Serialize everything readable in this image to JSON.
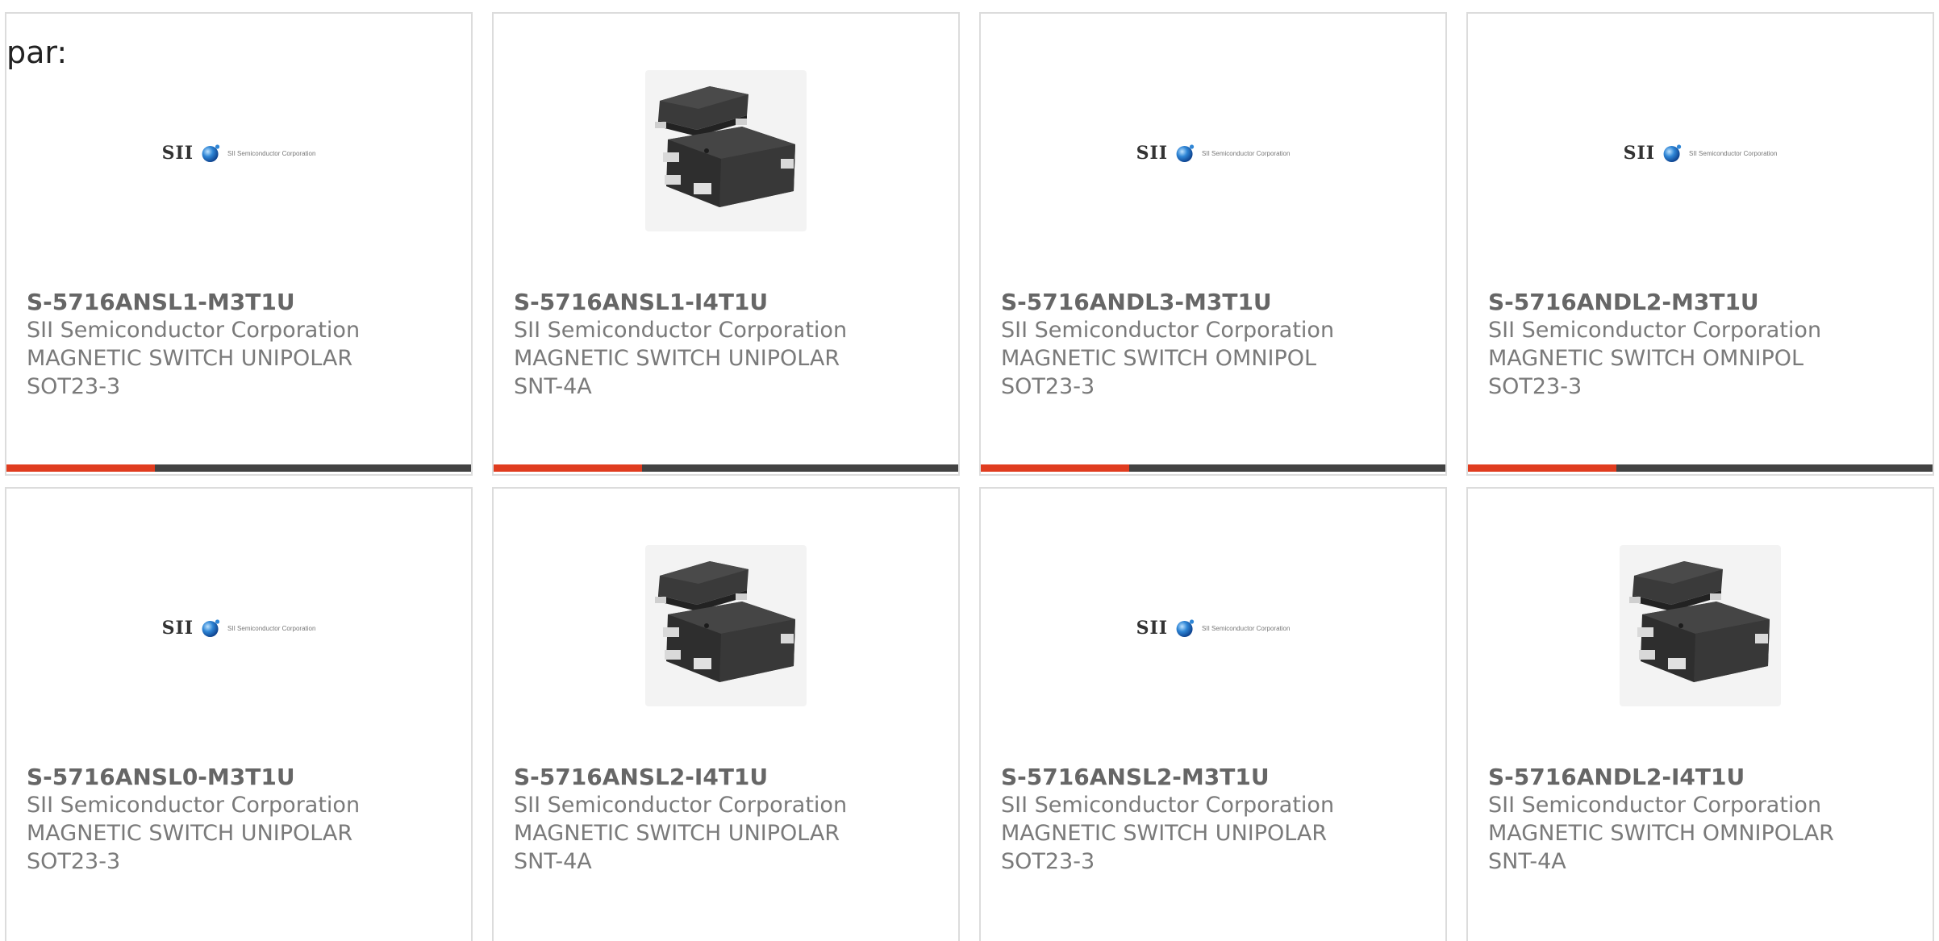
{
  "intro_text": "par:",
  "logo": {
    "brand": "SII",
    "corporation": "SII Semiconductor Corporation"
  },
  "colors": {
    "accent": "#e03c1f",
    "bar_track": "#424242",
    "card_border": "#dcdcdc",
    "text": "#7a7a7a"
  },
  "products": [
    {
      "part_number": "S-5716ANSL1-M3T1U",
      "manufacturer": "SII Semiconductor Corporation",
      "description": "MAGNETIC SWITCH UNIPOLAR",
      "package": "SOT23-3",
      "image": "sii-logo",
      "progress": 0.32
    },
    {
      "part_number": "S-5716ANSL1-I4T1U",
      "manufacturer": "SII Semiconductor Corporation",
      "description": "MAGNETIC SWITCH UNIPOLAR",
      "package": "SNT-4A",
      "image": "chip-photo",
      "progress": 0.32
    },
    {
      "part_number": "S-5716ANDL3-M3T1U",
      "manufacturer": "SII Semiconductor Corporation",
      "description": "MAGNETIC SWITCH OMNIPOL",
      "package": "SOT23-3",
      "image": "sii-logo",
      "progress": 0.32
    },
    {
      "part_number": "S-5716ANDL2-M3T1U",
      "manufacturer": "SII Semiconductor Corporation",
      "description": "MAGNETIC SWITCH OMNIPOL",
      "package": "SOT23-3",
      "image": "sii-logo",
      "progress": 0.32
    },
    {
      "part_number": "S-5716ANSL0-M3T1U",
      "manufacturer": "SII Semiconductor Corporation",
      "description": "MAGNETIC SWITCH UNIPOLAR",
      "package": "SOT23-3",
      "image": "sii-logo"
    },
    {
      "part_number": "S-5716ANSL2-I4T1U",
      "manufacturer": "SII Semiconductor Corporation",
      "description": "MAGNETIC SWITCH UNIPOLAR",
      "package": "SNT-4A",
      "image": "chip-photo"
    },
    {
      "part_number": "S-5716ANSL2-M3T1U",
      "manufacturer": "SII Semiconductor Corporation",
      "description": "MAGNETIC SWITCH UNIPOLAR",
      "package": "SOT23-3",
      "image": "sii-logo"
    },
    {
      "part_number": "S-5716ANDL2-I4T1U",
      "manufacturer": "SII Semiconductor Corporation",
      "description": "MAGNETIC SWITCH OMNIPOLAR",
      "package": "SNT-4A",
      "image": "chip-photo"
    }
  ]
}
